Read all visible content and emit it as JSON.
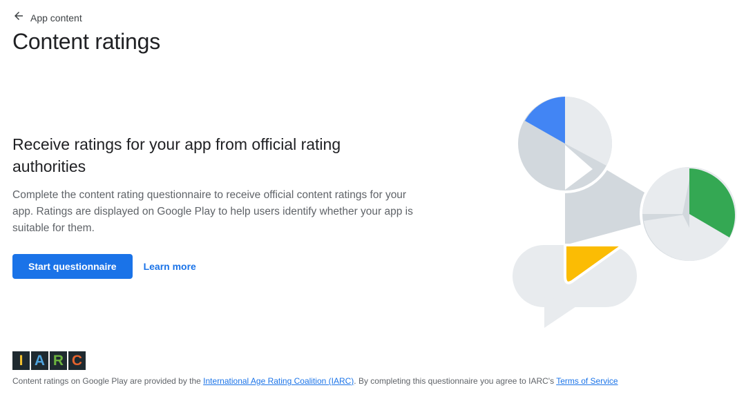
{
  "header": {
    "back_label": "App content",
    "title": "Content ratings"
  },
  "hero": {
    "heading": "Receive ratings for your app from official rating authorities",
    "description": "Complete the content rating questionnaire to receive official content ratings for your app. Ratings are displayed on Google Play to help users identify whether your app is suitable for them."
  },
  "actions": {
    "primary_label": "Start questionnaire",
    "secondary_label": "Learn more"
  },
  "iarc": {
    "letters": [
      "I",
      "A",
      "R",
      "C"
    ],
    "letter_colors": [
      "#f3c130",
      "#4ea3dd",
      "#6cb33f",
      "#e5632d"
    ]
  },
  "footer": {
    "text_before": "Content ratings on Google Play are provided by the ",
    "link1": "International Age Rating Coalition (IARC)",
    "text_middle": ". By completing this questionnaire you agree to IARC's ",
    "link2": "Terms of Service"
  },
  "colors": {
    "accent": "#1a73e8",
    "illustration_blue": "#4285f4",
    "illustration_green": "#34a853",
    "illustration_yellow": "#fbbc04",
    "illustration_grey_dark": "#d2d8dd",
    "illustration_grey_light": "#e8ebee"
  },
  "icons": {
    "back": "arrow-back-icon"
  }
}
